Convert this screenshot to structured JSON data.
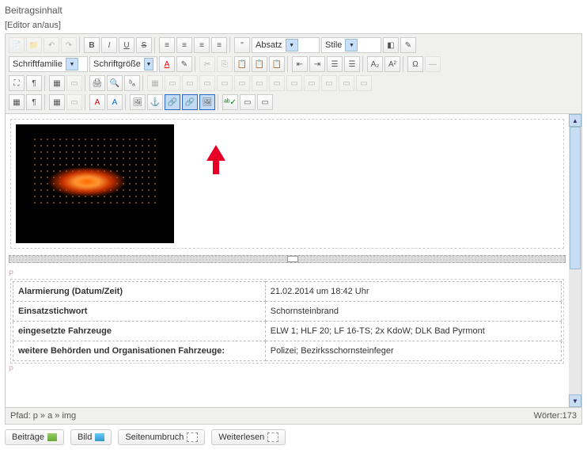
{
  "title": "Beitragsinhalt",
  "editor_toggle": "[Editor an/aus]",
  "selects": {
    "paragraph": "Absatz",
    "styles": "Stile",
    "font_family": "Schriftfamilie",
    "font_size": "Schriftgröße"
  },
  "table": {
    "rows": [
      {
        "label": "Alarmierung (Datum/Zeit)",
        "value": "21.02.2014 um 18:42 Uhr"
      },
      {
        "label": "Einsatzstichwort",
        "value": "Schornsteinbrand"
      },
      {
        "label": "eingesetzte Fahrzeuge",
        "value": "ELW 1; HLF 20; LF 16-TS; 2x KdoW; DLK Bad Pyrmont"
      },
      {
        "label": "weitere Behörden und Organisationen Fahrzeuge:",
        "value": "Polizei; Bezirksschornsteinfeger"
      }
    ]
  },
  "status": {
    "path_label": "Pfad:",
    "path": "p » a » img",
    "words_label": "Wörter:",
    "words": "173"
  },
  "bottom": {
    "b1": "Beiträge",
    "b2": "Bild",
    "b3": "Seitenumbruch",
    "b4": "Weiterlesen"
  },
  "p_marker": "P"
}
